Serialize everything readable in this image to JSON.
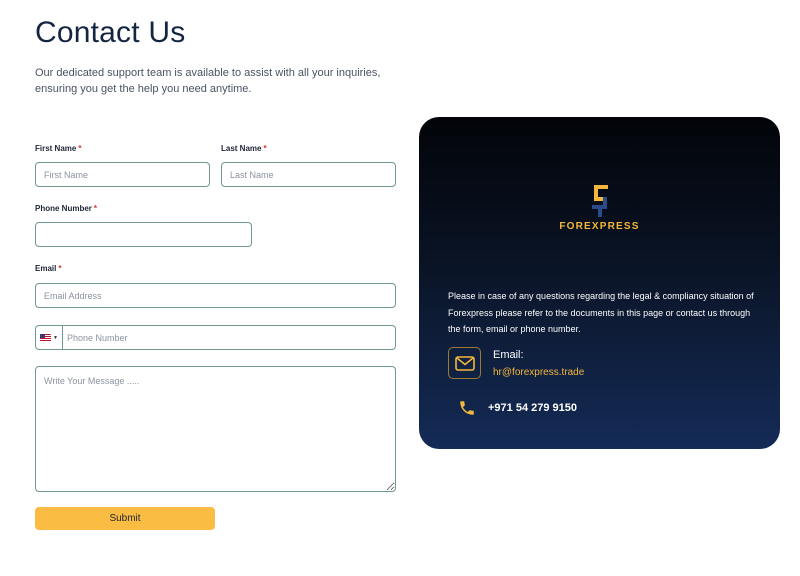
{
  "header": {
    "title": "Contact Us",
    "subtitle": "Our dedicated support team is available to assist with all your inquiries, ensuring you get the help you need anytime."
  },
  "form": {
    "first_name": {
      "label": "First Name",
      "required_mark": "*",
      "placeholder": "First Name",
      "value": ""
    },
    "last_name": {
      "label": "Last Name",
      "required_mark": "*",
      "placeholder": "Last Name",
      "value": ""
    },
    "phone": {
      "label": "Phone Number",
      "required_mark": "*",
      "placeholder": "",
      "value": ""
    },
    "email": {
      "label": "Email",
      "required_mark": "*",
      "placeholder": "Email Address",
      "value": ""
    },
    "intl_phone": {
      "country": "US",
      "flag_icon": "us-flag-icon",
      "placeholder": "Phone Number",
      "value": ""
    },
    "message": {
      "placeholder": "Write Your Message .....",
      "value": ""
    },
    "submit_label": "Submit"
  },
  "info_card": {
    "logo_text": "FOREXPRESS",
    "description": "Please in case of any questions regarding the legal & compliancy situation of Forexpress please refer to the documents in this page or contact us through the form, email or phone number.",
    "email_label": "Email:",
    "email_value": "hr@forexpress.trade",
    "phone_value": "+971 54 279 9150"
  },
  "colors": {
    "accent": "#fbbc44",
    "gold_text": "#f5b73b",
    "card_top": "#020408",
    "card_bottom": "#142b57",
    "field_border": "#6e9890",
    "required": "#d93025"
  },
  "icons": [
    "forexpress-logo-icon",
    "mail-icon",
    "phone-icon",
    "us-flag-icon",
    "chevron-down-icon"
  ]
}
